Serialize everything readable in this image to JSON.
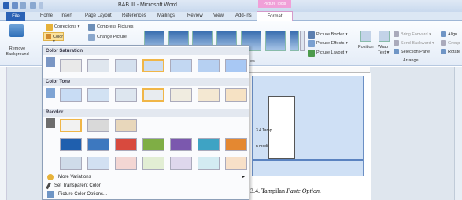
{
  "window": {
    "title": "BAB III - Microsoft Word",
    "contextual_tab": "Picture Tools"
  },
  "tabs": [
    "Home",
    "Insert",
    "Page Layout",
    "References",
    "Mailings",
    "Review",
    "View",
    "Add-Ins"
  ],
  "file_tab": "File",
  "format_tab": "Format",
  "ribbon": {
    "remove_bg": "Remove Background",
    "corrections": "Corrections ▾",
    "color": "Color ▾",
    "compress": "Compress Pictures",
    "change": "Change Picture",
    "picture_border": "Picture Border ▾",
    "picture_effects": "Picture Effects ▾",
    "picture_layout": "Picture Layout ▾",
    "position": "Position",
    "wrap_text": "Wrap Text ▾",
    "bring_forward": "Bring Forward ▾",
    "send_backward": "Send Backward ▾",
    "selection_pane": "Selection Pane",
    "align": "Align",
    "group": "Group",
    "rotate": "Rotate",
    "arrange_label": "Arrange",
    "styles_label": "es"
  },
  "dropdown": {
    "sections": {
      "saturation": "Color Saturation",
      "tone": "Color Tone",
      "recolor": "Recolor"
    },
    "items": {
      "more_variations": "More Variations",
      "set_transparent": "Set Transparent Color",
      "picture_options": "Picture Color Options..."
    }
  },
  "document": {
    "caption_prefix": "3.4. Tampilan ",
    "caption_italic": "Paste Option.",
    "caption_partial": "3.4 Tamp",
    "small_text": "n modi"
  },
  "colors": {
    "accent": "#f0b648",
    "file_tab": "#2a61b5",
    "contextual": "#f0a0d8"
  }
}
